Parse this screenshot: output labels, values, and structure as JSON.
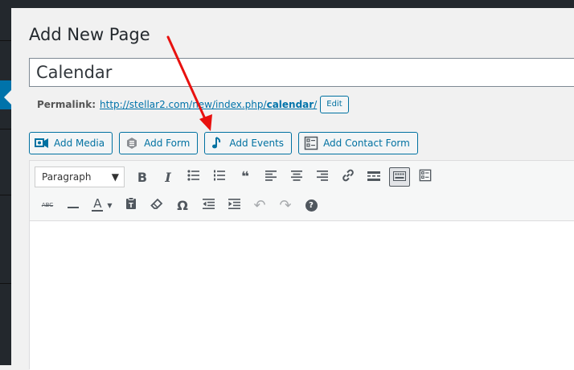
{
  "page": {
    "title": "Add New Page",
    "post_title": "Calendar"
  },
  "permalink": {
    "label": "Permalink:",
    "url_base": "http://stellar2.com/new/index.php/",
    "slug": "calendar",
    "url_suffix": "/",
    "edit_label": "Edit"
  },
  "media_buttons": [
    {
      "label": "Add Media",
      "icon": "media-icon"
    },
    {
      "label": "Add Form",
      "icon": "form-icon"
    },
    {
      "label": "Add Events",
      "icon": "music-note-icon"
    },
    {
      "label": "Add Contact Form",
      "icon": "contact-form-icon"
    }
  ],
  "toolbar": {
    "format_select": "Paragraph",
    "row1_icons": [
      "bold-icon",
      "italic-icon",
      "bullet-list-icon",
      "numbered-list-icon",
      "blockquote-icon",
      "align-left-icon",
      "align-center-icon",
      "align-right-icon",
      "link-icon",
      "read-more-icon",
      "toolbar-toggle-icon",
      "form-icon"
    ],
    "row2_icons": [
      "strikethrough-icon",
      "horizontal-line-icon",
      "text-color-icon",
      "paste-text-icon",
      "clear-formatting-icon",
      "special-character-icon",
      "outdent-icon",
      "indent-icon",
      "undo-icon",
      "redo-icon",
      "help-icon"
    ],
    "glyphs": {
      "bold": "B",
      "italic": "I",
      "quote": "❝",
      "strike": "ABC",
      "text_color": "A",
      "omega": "Ω",
      "undo": "↶",
      "redo": "↷",
      "help": "?"
    }
  },
  "colors": {
    "accent": "#0073aa",
    "annotation_arrow": "#e8110f",
    "admin_bar": "#23282d"
  }
}
